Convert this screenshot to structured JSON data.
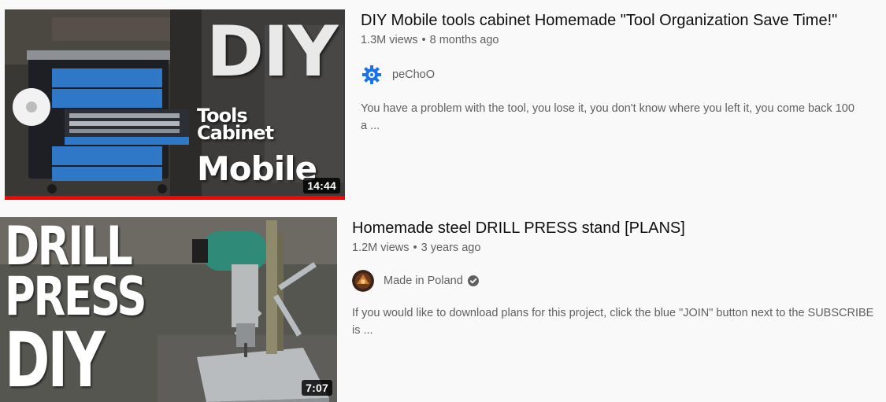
{
  "videos": [
    {
      "title": "DIY Mobile tools cabinet Homemade \"Tool Organization Save Time!\"",
      "views": "1.3M views",
      "age": "8 months ago",
      "channel": "peChoO",
      "description_line1": "You have a problem with the tool, you lose it, you don't know where you left it, you come back 100",
      "description_line2": "a ...",
      "duration": "14:44",
      "watch_progress_percent": 100,
      "thumbnail_text": [
        "DIY",
        "Tools",
        "Cabinet",
        "Mobile"
      ],
      "channel_icon": "gear-logo-icon",
      "colors": {
        "cabinet_blue": "#2f78c8",
        "logo_blue": "#1a73e8"
      }
    },
    {
      "title": "Homemade steel DRILL PRESS stand [PLANS]",
      "views": "1.2M views",
      "age": "3 years ago",
      "channel": "Made in Poland",
      "verified": true,
      "description_line1": "If you would like to download plans for this project, click the blue \"JOIN\" button next to the SUBSCRIBE",
      "description_line2": "is ...",
      "duration": "7:07",
      "thumbnail_text": [
        "DRILL",
        "PRESS",
        "DIY"
      ],
      "channel_icon": "avatar",
      "colors": {
        "drill_green": "#2f8a78"
      }
    }
  ],
  "separator": "•",
  "colors": {
    "background": "#f9f9f9",
    "progress": "#ff0000",
    "meta": "#606060"
  }
}
